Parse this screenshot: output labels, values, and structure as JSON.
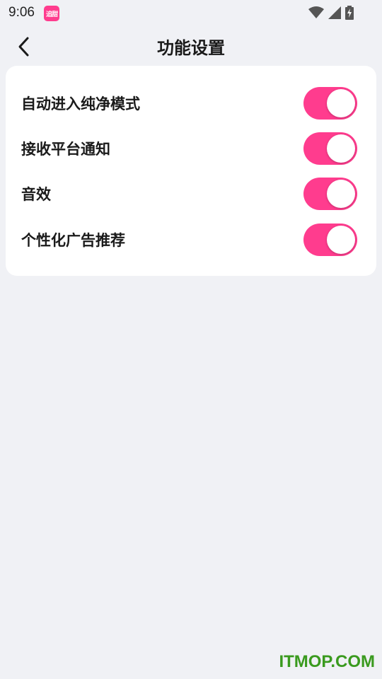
{
  "status_bar": {
    "time": "9:06",
    "app_badge_text": "追甜",
    "icons": [
      "wifi-icon",
      "signal-icon",
      "battery-charging-icon"
    ]
  },
  "header": {
    "title": "功能设置",
    "back_icon": "chevron-left-icon"
  },
  "settings": [
    {
      "label": "自动进入纯净模式",
      "enabled": true
    },
    {
      "label": "接收平台通知",
      "enabled": true
    },
    {
      "label": "音效",
      "enabled": true
    },
    {
      "label": "个性化广告推荐",
      "enabled": true
    }
  ],
  "colors": {
    "accent": "#ff3c8e",
    "background": "#f0f1f5",
    "card": "#ffffff",
    "watermark": "#3a9a1e"
  },
  "watermark": "ITMOP.COM"
}
